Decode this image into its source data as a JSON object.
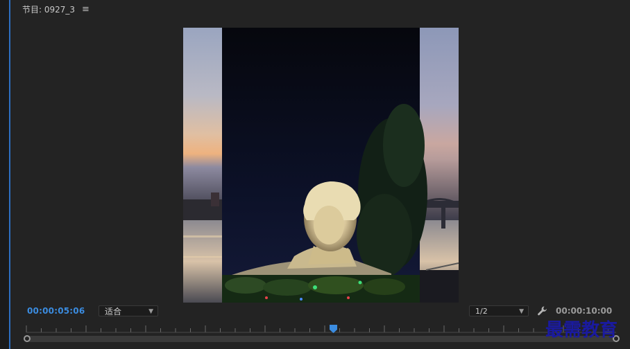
{
  "header": {
    "title": "节目: 0927_3",
    "menu_icon": "≡"
  },
  "timecode": {
    "current": "00:00:05:06",
    "duration": "00:00:10:00"
  },
  "zoom": {
    "selected": "适合"
  },
  "resolution": {
    "selected": "1/2"
  },
  "watermark": {
    "text": "最需教育"
  },
  "playback": {
    "position_fraction": 0.52
  },
  "colors": {
    "accent": "#3b8ce0",
    "panel": "#232323",
    "watermark": "#1a1aa0"
  }
}
